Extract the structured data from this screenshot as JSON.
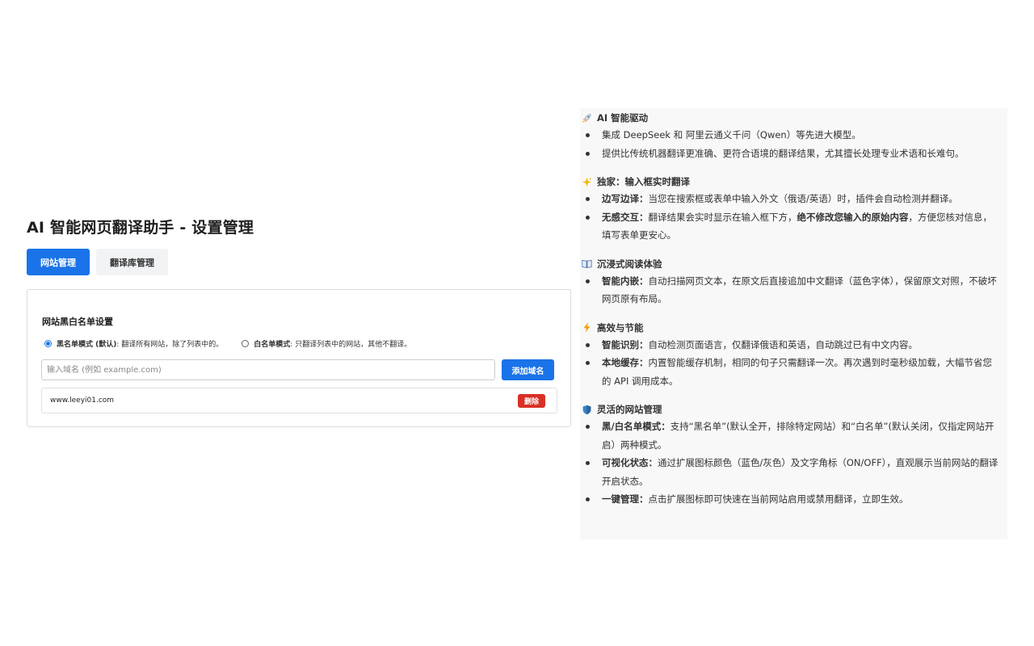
{
  "page_title": "AI 智能网页翻译助手 - 设置管理",
  "tabs": [
    {
      "label": "网站管理",
      "active": true
    },
    {
      "label": "翻译库管理",
      "active": false
    }
  ],
  "blacklist_card": {
    "title": "网站黑白名单设置",
    "modes": [
      {
        "label": "黑名单模式 (默认)",
        "description": ": 翻译所有网站，除了列表中的。",
        "checked": true
      },
      {
        "label": "白名单模式",
        "description": ": 只翻译列表中的网站，其他不翻译。",
        "checked": false
      }
    ],
    "input_placeholder": "输入域名 (例如 example.com)",
    "input_value": "",
    "add_button": "添加域名",
    "domains": [
      {
        "domain": "www.leeyi01.com",
        "delete_label": "删除"
      }
    ]
  },
  "features": [
    {
      "icon": "rocket-icon",
      "heading": "AI 智能驱动",
      "items": [
        {
          "bold": "",
          "text": "集成 DeepSeek 和 阿里云通义千问（Qwen）等先进大模型。"
        },
        {
          "bold": "",
          "text": "提供比传统机器翻译更准确、更符合语境的翻译结果，尤其擅长处理专业术语和长难句。"
        }
      ]
    },
    {
      "icon": "sparkles-icon",
      "heading": "独家：输入框实时翻译",
      "items": [
        {
          "bold": "边写边译：",
          "text": "当您在搜索框或表单中输入外文（俄语/英语）时，插件会自动检测并翻译。"
        },
        {
          "bold": "无感交互：",
          "text": "翻译结果会实时显示在输入框下方，",
          "bold2": "绝不修改您输入的原始内容",
          "text2": "，方便您核对信息，填写表单更安心。"
        }
      ]
    },
    {
      "icon": "book-icon",
      "heading": "沉浸式阅读体验",
      "items": [
        {
          "bold": "智能内嵌：",
          "text": "自动扫描网页文本，在原文后直接追加中文翻译（蓝色字体），保留原文对照，不破坏网页原有布局。"
        }
      ]
    },
    {
      "icon": "lightning-icon",
      "heading": "高效与节能",
      "items": [
        {
          "bold": "智能识别：",
          "text": "自动检测页面语言，仅翻译俄语和英语，自动跳过已有中文内容。"
        },
        {
          "bold": "本地缓存：",
          "text": "内置智能缓存机制，相同的句子只需翻译一次。再次遇到时毫秒级加载，大幅节省您的 API 调用成本。"
        }
      ]
    },
    {
      "icon": "shield-icon",
      "heading": "灵活的网站管理",
      "items": [
        {
          "bold": "黑/白名单模式：",
          "text": "支持“黑名单”(默认全开，排除特定网站）和“白名单”(默认关闭，仅指定网站开启）两种模式。"
        },
        {
          "bold": "可视化状态：",
          "text": "通过扩展图标颜色（蓝色/灰色）及文字角标（ON/OFF），直观展示当前网站的翻译开启状态。"
        },
        {
          "bold": "一键管理：",
          "text": "点击扩展图标即可快速在当前网站启用或禁用翻译，立即生效。"
        }
      ]
    }
  ],
  "colors": {
    "primary": "#1a73e8",
    "danger": "#d93025",
    "panel_bg": "#f8f8f8"
  }
}
